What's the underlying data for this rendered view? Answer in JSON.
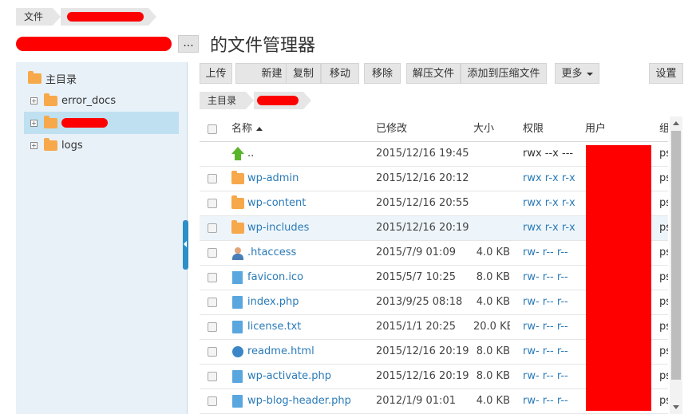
{
  "top_breadcrumb": {
    "root": "文件"
  },
  "title": {
    "more_label": "...",
    "suffix": "的文件管理器"
  },
  "tree": {
    "root_label": "主目录",
    "items": [
      {
        "label": "error_docs",
        "expand": "+"
      },
      {
        "label": "",
        "expand": "+"
      },
      {
        "label": "logs",
        "expand": "+"
      }
    ]
  },
  "toolbar": {
    "upload": "上传",
    "new": "新建",
    "copy": "复制",
    "move": "移动",
    "remove": "移除",
    "extract": "解压文件",
    "add_to_archive": "添加到压缩文件",
    "more": "更多",
    "settings": "设置"
  },
  "path": {
    "root": "主目录"
  },
  "columns": {
    "name": "名称",
    "modified": "已修改",
    "size": "大小",
    "permissions": "权限",
    "user": "用户",
    "group": "组"
  },
  "files": [
    {
      "icon": "up-arrow-icon",
      "name": "..",
      "modified": "2015/12/16 19:45",
      "size": "",
      "perm": "rwx --x ---",
      "group": "ps",
      "perm_link": false,
      "is_link": false,
      "checkbox": false
    },
    {
      "icon": "folder-icon",
      "name": "wp-admin",
      "modified": "2015/12/16 20:12",
      "size": "",
      "perm": "rwx r-x r-x",
      "group": "ps",
      "perm_link": true,
      "is_link": true,
      "checkbox": true
    },
    {
      "icon": "folder-icon",
      "name": "wp-content",
      "modified": "2015/12/16 20:55",
      "size": "",
      "perm": "rwx r-x r-x",
      "group": "ps",
      "perm_link": true,
      "is_link": true,
      "checkbox": true
    },
    {
      "icon": "folder-icon",
      "name": "wp-includes",
      "modified": "2015/12/16 20:19",
      "size": "",
      "perm": "rwx r-x r-x",
      "group": "ps",
      "perm_link": true,
      "is_link": true,
      "checkbox": true
    },
    {
      "icon": "user-file-icon",
      "name": ".htaccess",
      "modified": "2015/7/9 01:09",
      "size": "4.0 KB",
      "perm": "rw- r-- r--",
      "group": "ps",
      "perm_link": true,
      "is_link": true,
      "checkbox": true
    },
    {
      "icon": "favicon-file-icon",
      "name": "favicon.ico",
      "modified": "2015/5/7 10:25",
      "size": "8.0 KB",
      "perm": "rw- r-- r--",
      "group": "ps",
      "perm_link": true,
      "is_link": true,
      "checkbox": true
    },
    {
      "icon": "document-icon",
      "name": "index.php",
      "modified": "2013/9/25 08:18",
      "size": "4.0 KB",
      "perm": "rw- r-- r--",
      "group": "ps",
      "perm_link": true,
      "is_link": true,
      "checkbox": true
    },
    {
      "icon": "document-icon",
      "name": "license.txt",
      "modified": "2015/1/1 20:25",
      "size": "20.0 KB",
      "perm": "rw- r-- r--",
      "group": "ps",
      "perm_link": true,
      "is_link": true,
      "checkbox": true
    },
    {
      "icon": "html-file-icon",
      "name": "readme.html",
      "modified": "2015/12/16 20:19",
      "size": "8.0 KB",
      "perm": "rw- r-- r--",
      "group": "ps",
      "perm_link": true,
      "is_link": true,
      "checkbox": true
    },
    {
      "icon": "document-icon",
      "name": "wp-activate.php",
      "modified": "2015/12/16 20:19",
      "size": "8.0 KB",
      "perm": "rw- r-- r--",
      "group": "ps",
      "perm_link": true,
      "is_link": true,
      "checkbox": true
    },
    {
      "icon": "document-icon",
      "name": "wp-blog-header.php",
      "modified": "2012/1/9 01:01",
      "size": "4.0 KB",
      "perm": "rw- r-- r--",
      "group": "ps",
      "perm_link": true,
      "is_link": true,
      "checkbox": true
    }
  ],
  "highlight_row": 3
}
